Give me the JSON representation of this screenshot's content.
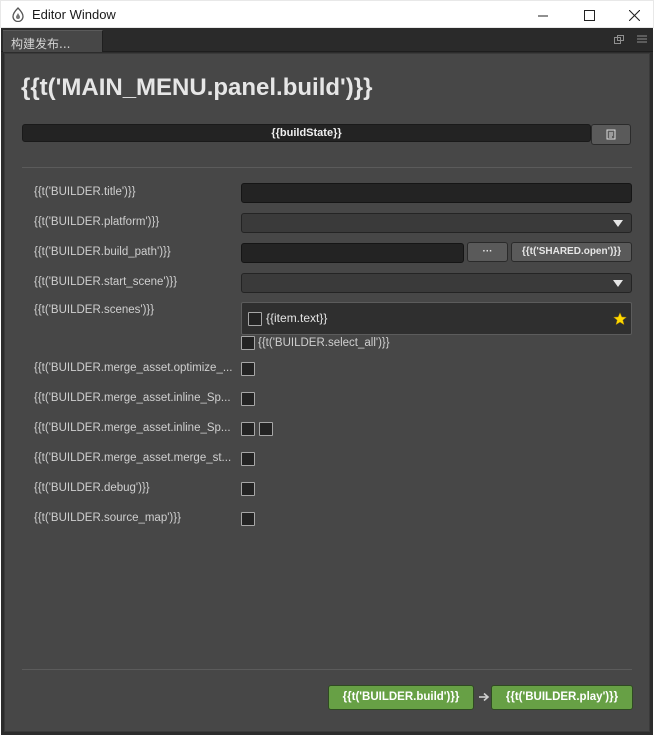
{
  "window": {
    "title": "Editor Window"
  },
  "tab": {
    "label": "构建发布..."
  },
  "page_title": "{{t('MAIN_MENU.panel.build')}}",
  "build_state": "{{buildState}}",
  "fields": {
    "title_label": "{{t('BUILDER.title')}}",
    "platform_label": "{{t('BUILDER.platform')}}",
    "build_path_label": "{{t('BUILDER.build_path')}}",
    "browse_label": "···",
    "open_label": "{{t('SHARED.open')}}",
    "start_scene_label": "{{t('BUILDER.start_scene')}}",
    "scenes_label": "{{t('BUILDER.scenes')}}",
    "scene_item_text": "{{item.text}}",
    "select_all_label": "{{t('BUILDER.select_all')}}",
    "optimize_label": "{{t('BUILDER.merge_asset.optimize_...",
    "inline_sp1_label": "{{t('BUILDER.merge_asset.inline_Sp...",
    "inline_sp2_label": "{{t('BUILDER.merge_asset.inline_Sp...",
    "merge_st_label": "{{t('BUILDER.merge_asset.merge_st...",
    "debug_label": "{{t('BUILDER.debug')}}",
    "source_map_label": "{{t('BUILDER.source_map')}}"
  },
  "footer": {
    "build_label": "{{t('BUILDER.build')}}",
    "play_label": "{{t('BUILDER.play')}}"
  },
  "colors": {
    "panel_bg": "#474747",
    "accent_green": "#67a045",
    "star_yellow": "#ffd900"
  },
  "icons": {
    "app": "app-logo-icon",
    "folder": "folder-icon",
    "star": "star-icon",
    "arrow": "arrow-right-icon"
  }
}
